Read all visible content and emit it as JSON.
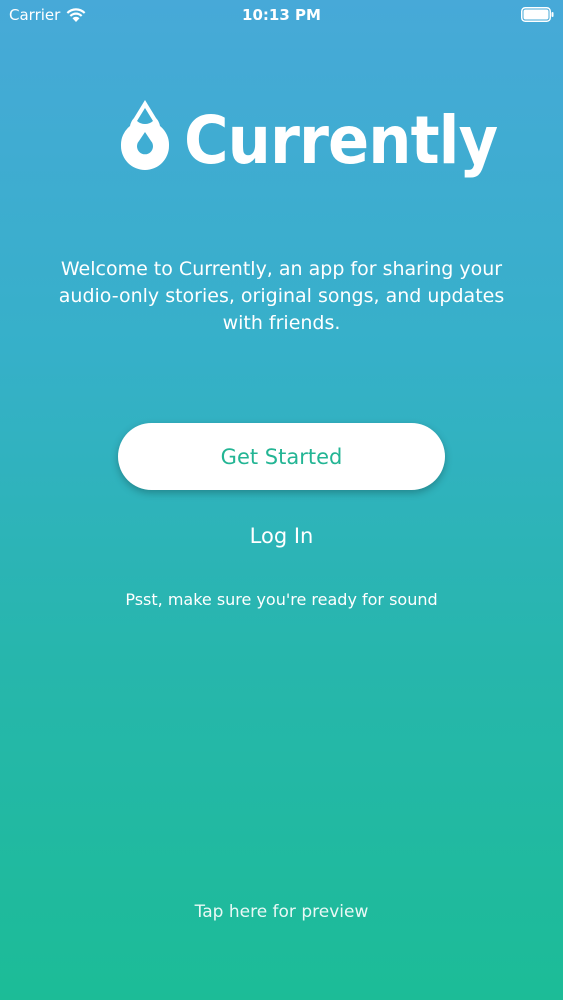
{
  "status_bar": {
    "carrier": "Carrier",
    "time": "10:13 PM",
    "wifi_icon": "wifi-icon",
    "battery_icon": "battery-icon"
  },
  "logo": {
    "icon": "water-drop-icon",
    "text": "Currently"
  },
  "welcome": {
    "text": "Welcome to Currently, an app for sharing your audio-only stories, original songs, and updates with friends."
  },
  "actions": {
    "get_started_label": "Get Started",
    "login_label": "Log In"
  },
  "hint": {
    "text": "Psst, make sure you're ready for sound"
  },
  "preview": {
    "label": "Tap here for preview"
  },
  "colors": {
    "gradient_top": "#47a9d8",
    "gradient_bottom": "#1cbc97",
    "button_text": "#23b594"
  }
}
